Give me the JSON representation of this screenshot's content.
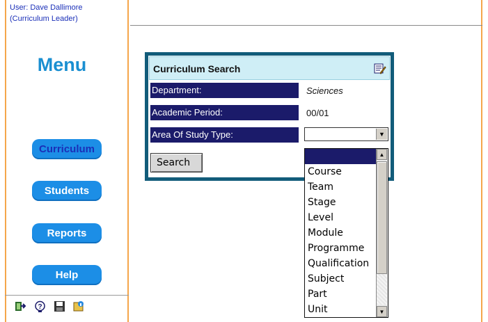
{
  "user": {
    "name_line": "User: Dave Dallimore",
    "role_line": "(Curriculum Leader)"
  },
  "menu": {
    "title": "Menu",
    "items": [
      {
        "label": "Curriculum",
        "active": true
      },
      {
        "label": "Students",
        "active": false
      },
      {
        "label": "Reports",
        "active": false
      },
      {
        "label": "Help",
        "active": false
      }
    ]
  },
  "toolbar_icons": [
    "exit-icon",
    "help-icon",
    "save-icon",
    "info-icon"
  ],
  "panel": {
    "title": "Curriculum Search",
    "header_icon": "edit-icon",
    "rows": [
      {
        "label": "Department:",
        "value": "Sciences"
      },
      {
        "label": "Academic Period:",
        "value": "00/01"
      },
      {
        "label": "Area Of Study Type:",
        "value": ""
      }
    ],
    "search_button": "Search"
  },
  "dropdown": {
    "options": [
      "",
      "Course",
      "Team",
      "Stage",
      "Level",
      "Module",
      "Programme",
      "Qualification",
      "Subject",
      "Part",
      "Unit"
    ],
    "selected_index": 0
  },
  "colors": {
    "frame_orange": "#f5a64a",
    "menu_button_blue": "#1c8ee6",
    "label_navy": "#1b1b6a",
    "panel_border_teal": "#125c7a",
    "panel_header_bg": "#cfeef6"
  }
}
